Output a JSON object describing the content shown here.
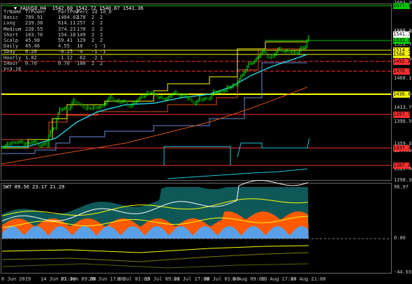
{
  "header": {
    "title": "XAUUSD,H4  1542.60 1542.72 1540.87 1541.36",
    "icon": "triangle-down-icon"
  },
  "table": {
    "columns": [
      "TrName",
      "TrPower",
      "PartPow",
      "Perc",
      "1d",
      "1d_0"
    ],
    "rows": [
      [
        "Basic",
        "789.91",
        "1404.02",
        "178",
        "2",
        "2"
      ],
      [
        "Long",
        "239.38",
        "614.11",
        "257",
        "2",
        "2"
      ],
      [
        "Medium",
        "220.55",
        "374.23",
        "170",
        "2",
        "2"
      ],
      [
        "Short",
        "103.76",
        "154.18",
        "149",
        "2",
        "2"
      ],
      [
        "Scalp",
        "45.98",
        "59.41",
        "129",
        "2",
        "2"
      ],
      [
        "Daily",
        "45.46",
        "4.55",
        "10",
        "-1",
        "-1"
      ],
      [
        "IDay",
        "6.26",
        "-0.25",
        "-4",
        "-1",
        "-1"
      ],
      [
        "Hourly",
        "1.82",
        "-1.12",
        "-62",
        "-2",
        "1"
      ],
      [
        "IHour",
        "0.70",
        "0.70",
        "100",
        "2",
        "2"
      ]
    ],
    "footer": "V=3.16"
  },
  "price_axis": [
    "1603.30",
    "1568.30",
    "1546.90",
    "1524.70",
    "1503.00",
    "1468.10",
    "1436.60",
    "1413.70",
    "1390.50",
    "1359.35",
    "1344.90",
    "1321.40",
    "1298.30"
  ],
  "price_labels": [
    {
      "text": "1577.15",
      "bg": "#00c800",
      "fg": "#000000"
    },
    {
      "text": "1541.36",
      "bg": "#ffffff",
      "fg": "#000000"
    },
    {
      "text": "1533.00",
      "bg": "#00c800",
      "fg": "#000000"
    },
    {
      "text": "1514.40",
      "bg": "#ffff00",
      "fg": "#000000"
    },
    {
      "text": "1508.20",
      "bg": "#ffff00",
      "fg": "#000000"
    },
    {
      "text": "1492.85",
      "bg": "#ff3030",
      "fg": "#000000"
    },
    {
      "text": "1476.75",
      "bg": "#ff3030",
      "fg": "#000000"
    },
    {
      "text": "1436.60",
      "bg": "#ffff00",
      "fg": "#000000"
    },
    {
      "text": "1397.50",
      "bg": "#ff3030",
      "fg": "#000000"
    },
    {
      "text": "1337.35",
      "bg": "#ff3030",
      "fg": "#000000"
    },
    {
      "text": "1307.80",
      "bg": "#ff3030",
      "fg": "#000000"
    }
  ],
  "indicator": {
    "title": "SWT 89.56 23.17 21.29",
    "axis": [
      "96.97",
      "0.00",
      "-44.03"
    ]
  },
  "dates": [
    "6 Jun 2019",
    "14 Jun 01:00",
    "21 Jun 09:00",
    "28 Jun 17:00",
    "8 Jul 01:00",
    "15 Jul 09:00",
    "22 Jul 17:00",
    "30 Jul 01:00",
    "6 Aug 09:00",
    "13 Aug 17:00",
    "20 Aug 21:00"
  ],
  "colors": {
    "background": "#000000",
    "candle_up": "#00ff00",
    "candle_down": "#00a000",
    "ma_fast": "#1fc8d8",
    "ma_slow": "#e05010",
    "support": "#ffff00",
    "resistance": "#ff3030",
    "osc_orange": "#ff5a00",
    "osc_blue": "#5aa0e8",
    "osc_teal": "#1aa0a0"
  }
}
